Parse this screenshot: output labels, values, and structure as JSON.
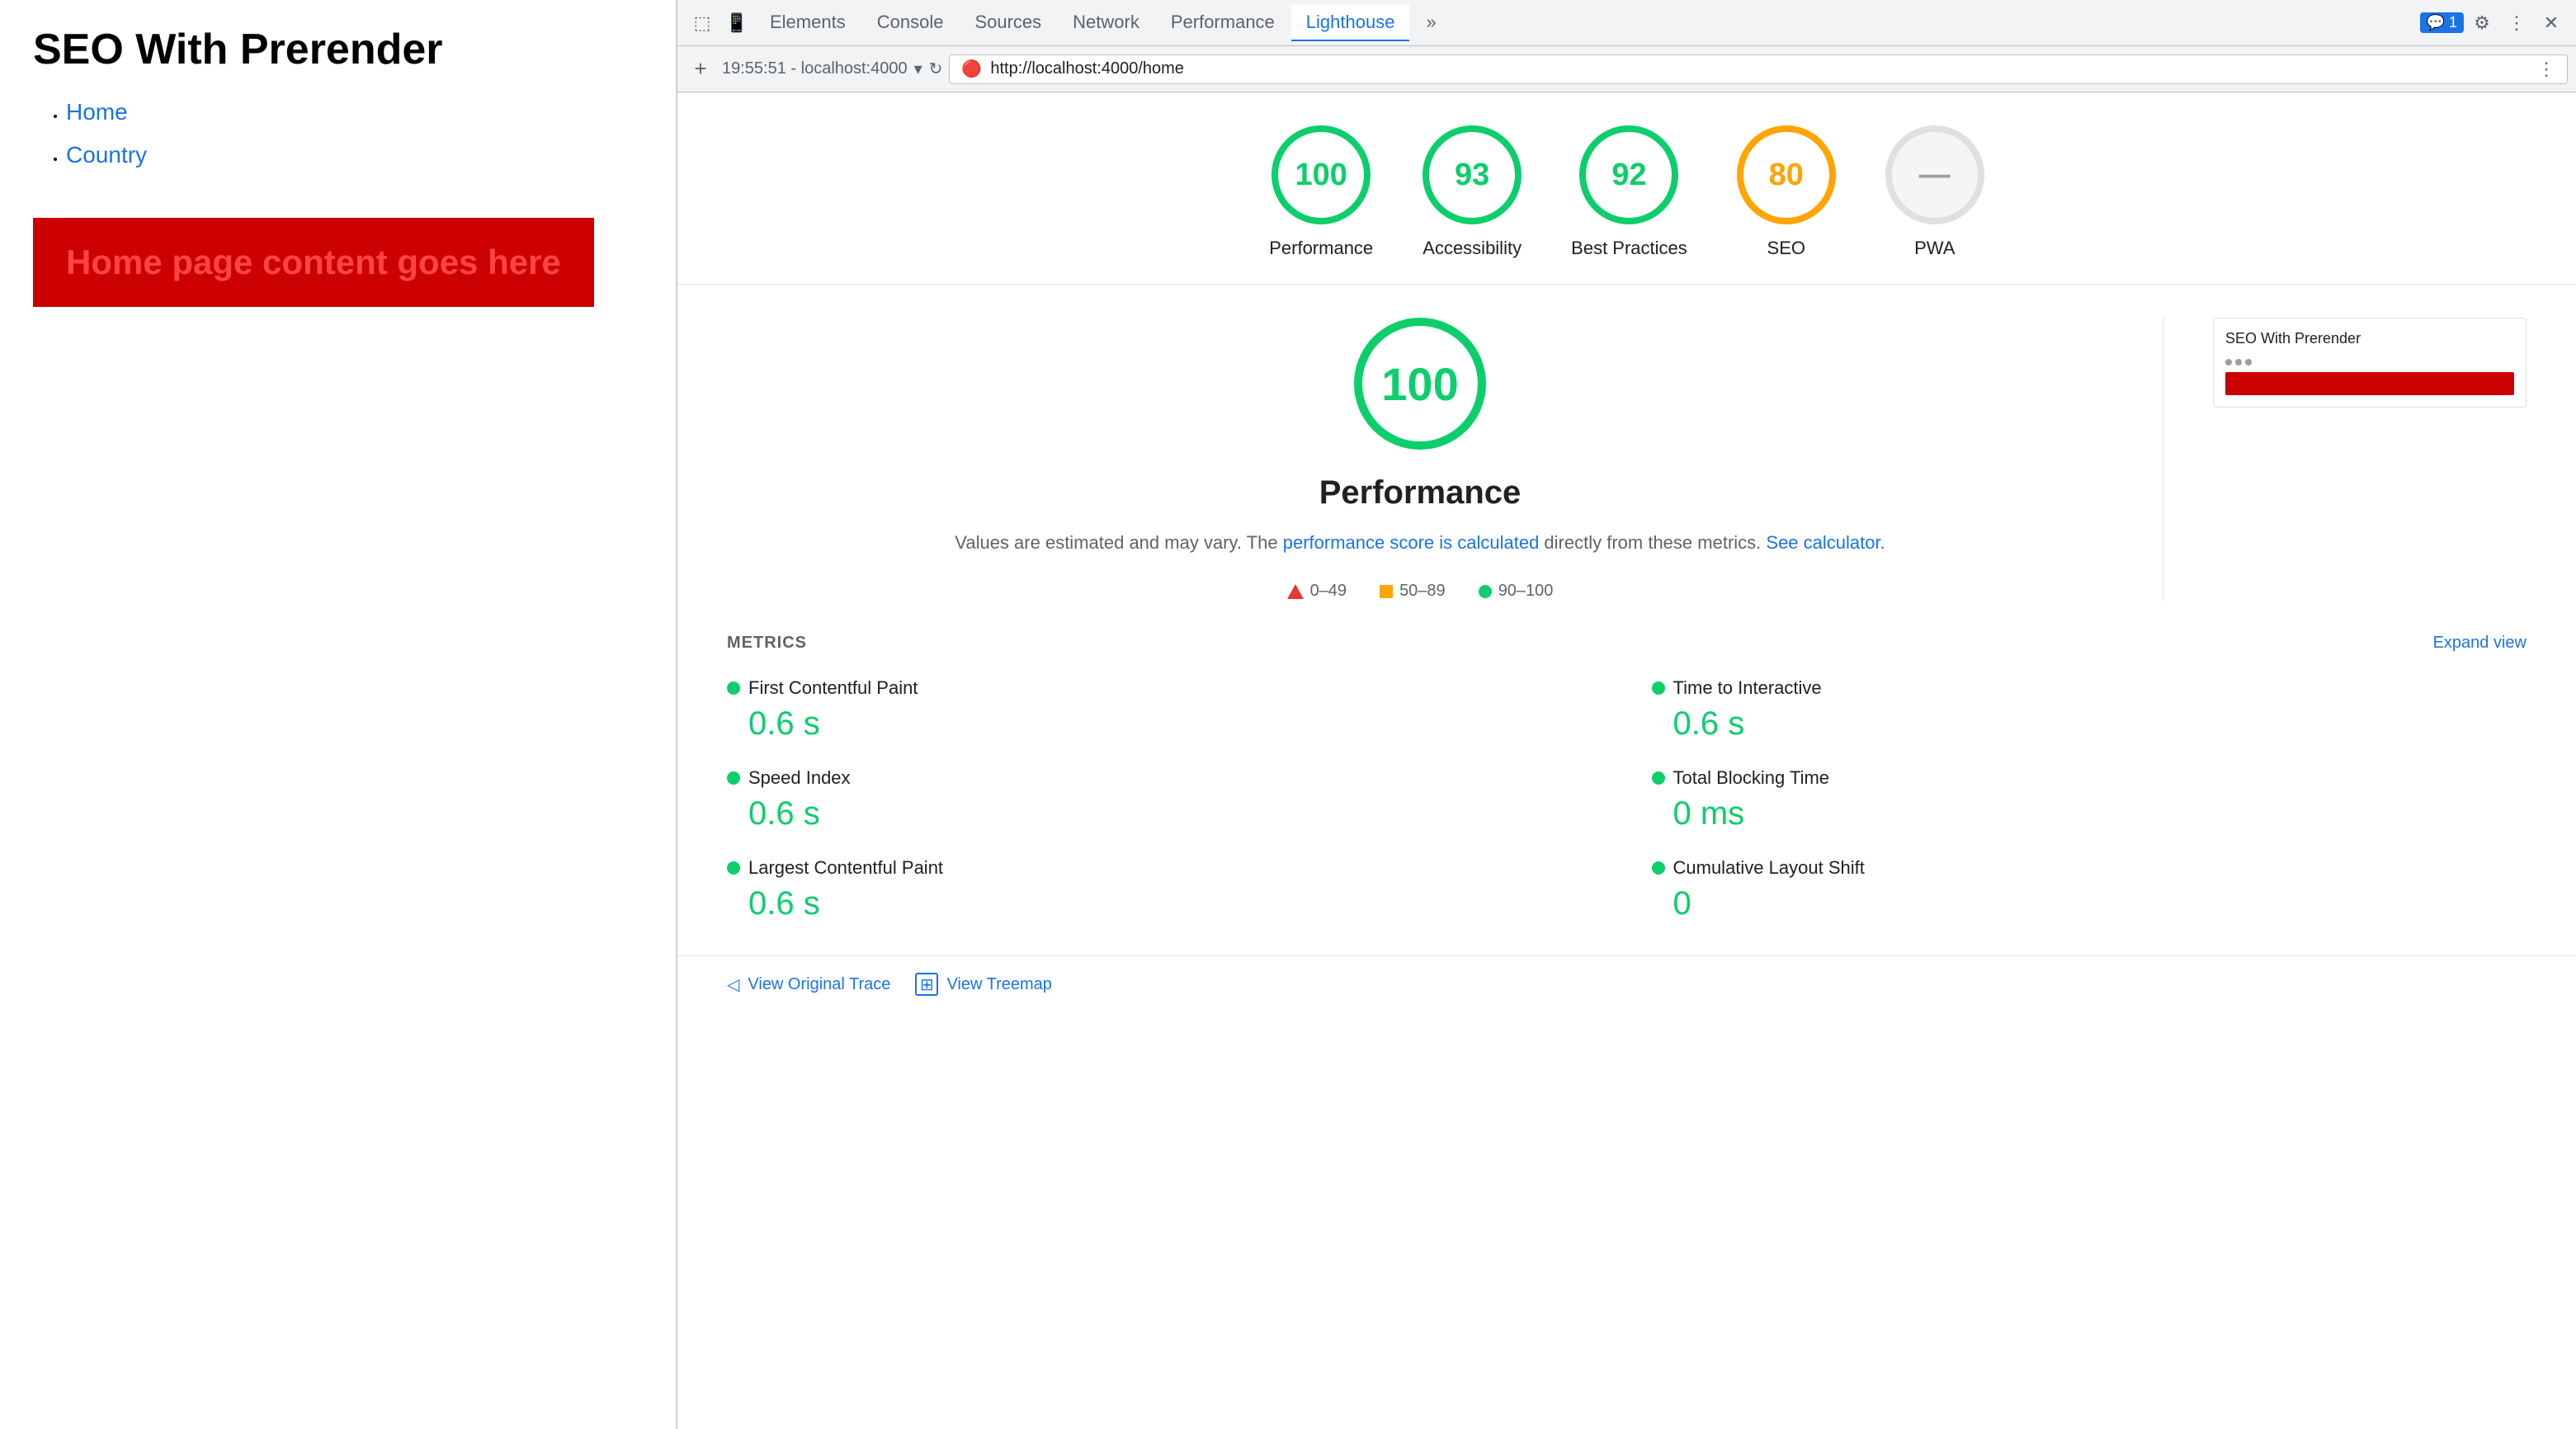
{
  "webpage": {
    "title": "SEO With Prerender",
    "nav": {
      "items": [
        {
          "label": "Home",
          "href": "#"
        },
        {
          "label": "Country",
          "href": "#"
        }
      ]
    },
    "home_banner": "Home page content goes here"
  },
  "devtools": {
    "tabs": [
      {
        "label": "Elements",
        "active": false
      },
      {
        "label": "Console",
        "active": false
      },
      {
        "label": "Sources",
        "active": false
      },
      {
        "label": "Network",
        "active": false
      },
      {
        "label": "Performance",
        "active": false
      },
      {
        "label": "Lighthouse",
        "active": true
      }
    ],
    "badge": "1",
    "address": "http://localhost:4000/home",
    "session_label": "19:55:51 - localhost:4000",
    "more_tabs": "»"
  },
  "lighthouse": {
    "scores": [
      {
        "value": "100",
        "label": "Performance",
        "type": "green"
      },
      {
        "value": "93",
        "label": "Accessibility",
        "type": "green"
      },
      {
        "value": "92",
        "label": "Best Practices",
        "type": "green"
      },
      {
        "value": "80",
        "label": "SEO",
        "type": "orange"
      },
      {
        "value": "—",
        "label": "PWA",
        "type": "gray"
      }
    ],
    "main_score": "100",
    "main_title": "Performance",
    "description_start": "Values are estimated and may vary. The ",
    "description_link1": "performance score is calculated",
    "description_mid": " directly from these metrics. ",
    "description_link2": "See calculator.",
    "legend": [
      {
        "range": "0–49",
        "type": "triangle"
      },
      {
        "range": "50–89",
        "type": "square"
      },
      {
        "range": "90–100",
        "type": "circle"
      }
    ],
    "screenshot": {
      "title": "SEO With Prerender"
    },
    "metrics_title": "METRICS",
    "expand_view": "Expand view",
    "metrics": [
      {
        "label": "First Contentful Paint",
        "value": "0.6 s"
      },
      {
        "label": "Time to Interactive",
        "value": "0.6 s"
      },
      {
        "label": "Speed Index",
        "value": "0.6 s"
      },
      {
        "label": "Total Blocking Time",
        "value": "0 ms"
      },
      {
        "label": "Largest Contentful Paint",
        "value": "0.6 s"
      },
      {
        "label": "Cumulative Layout Shift",
        "value": "0"
      }
    ],
    "bottom_actions": [
      {
        "label": "View Original Trace"
      },
      {
        "label": "View Treemap"
      }
    ]
  }
}
